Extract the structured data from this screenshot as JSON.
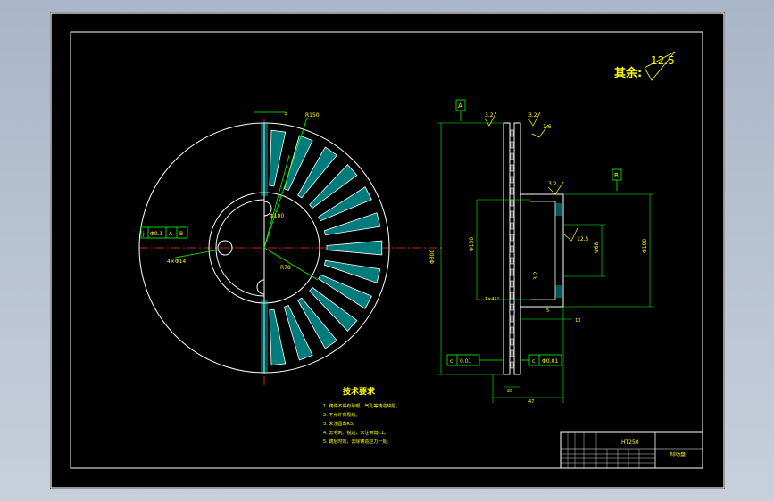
{
  "drawing": {
    "surface_finish": {
      "label": "其余:",
      "value": "12.5"
    },
    "datum_labels": {
      "a": "A",
      "b": "B"
    },
    "front_view": {
      "feature_control_frame": [
        "j",
        "Φ0.1",
        "A",
        "B"
      ],
      "hole_callout": "4×Φ14",
      "dim_outer": "R150",
      "dim_pcd": "Φ100",
      "dim_inner": "R78",
      "dim_thickness": "5"
    },
    "side_view": {
      "roughness_a": "3.2",
      "roughness_b": "3.2",
      "roughness_c": "1.6",
      "roughness_d": "3.2",
      "roughness_e": "3.2",
      "roughness_f": "12.5",
      "dim_disc_dia": "Φ300",
      "dim_hub_dia": "Φ150",
      "dim_bore": "Φ68",
      "dim_boss": "Φ100",
      "dim_chamfer": "1×45°",
      "dim_t1": "5",
      "dim_t2": "10",
      "dim_width": "28",
      "dim_total": "47",
      "frame_left": [
        "c",
        "0.01"
      ],
      "frame_right": [
        "c",
        "Φ0.01"
      ]
    },
    "technical_requirements": {
      "title": "技术要求",
      "items": [
        "1. 铸件不得有砂眼、气孔等铸造缺陷。",
        "2. 不允许有裂纹。",
        "3. 未注圆角R3。",
        "4. 去毛刺、锐边，未注倒角C1。",
        "5. 铸后时效，去除铸造应力一处。"
      ]
    },
    "title_block": {
      "material": "HT250",
      "part_name": "制动盘"
    }
  }
}
